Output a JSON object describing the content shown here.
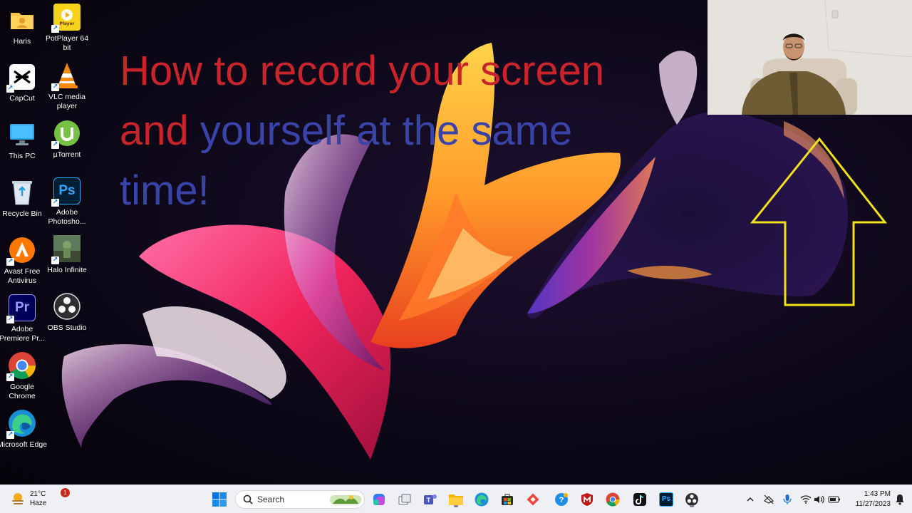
{
  "desktop": {
    "icons": [
      {
        "label": "Haris",
        "icon": "folder-user-icon"
      },
      {
        "label": "PotPlayer 64 bit",
        "icon": "potplayer-icon",
        "badge": "Player"
      },
      {
        "label": "CapCut",
        "icon": "capcut-icon"
      },
      {
        "label": "VLC media player",
        "icon": "vlc-icon"
      },
      {
        "label": "This PC",
        "icon": "monitor-icon"
      },
      {
        "label": "µTorrent",
        "icon": "utorrent-icon"
      },
      {
        "label": "Recycle Bin",
        "icon": "recycle-bin-icon"
      },
      {
        "label": "Adobe Photosho...",
        "icon": "photoshop-icon",
        "glyph": "Ps"
      },
      {
        "label": "Avast Free Antivirus",
        "icon": "avast-icon"
      },
      {
        "label": "Halo Infinite",
        "icon": "halo-icon"
      },
      {
        "label": "Adobe Premiere Pr...",
        "icon": "premiere-icon",
        "glyph": "Pr"
      },
      {
        "label": "OBS Studio",
        "icon": "obs-icon"
      },
      {
        "label": "Google Chrome",
        "icon": "chrome-icon"
      },
      {
        "label": "Microsoft Edge",
        "icon": "edge-icon"
      }
    ]
  },
  "overlay": {
    "line1": "How to record your screen",
    "line2_a": "and ",
    "line2_b": "yourself at the same",
    "line3": "time!",
    "colors": {
      "red": "#c9242b",
      "blue": "#3a43a8",
      "arrow": "#f2e21a"
    }
  },
  "taskbar": {
    "weather": {
      "temp": "21°C",
      "condition": "Haze"
    },
    "notification_count": "1",
    "search_placeholder": "Search",
    "pinned": [
      "windows-start-icon",
      "copilot-icon",
      "task-view-icon",
      "teams-icon",
      "file-explorer-icon",
      "edge-icon",
      "store-icon",
      "anydesk-icon",
      "help-icon",
      "mcafee-icon",
      "chrome-icon",
      "tiktok-icon",
      "photoshop-icon",
      "obs-icon"
    ],
    "tray": [
      "chevron-up-icon",
      "network-off-icon",
      "microphone-icon",
      "wifi-icon",
      "speaker-icon",
      "battery-icon"
    ],
    "time": "1:43 PM",
    "date": "11/27/2023",
    "photoshop_glyph": "Ps"
  }
}
